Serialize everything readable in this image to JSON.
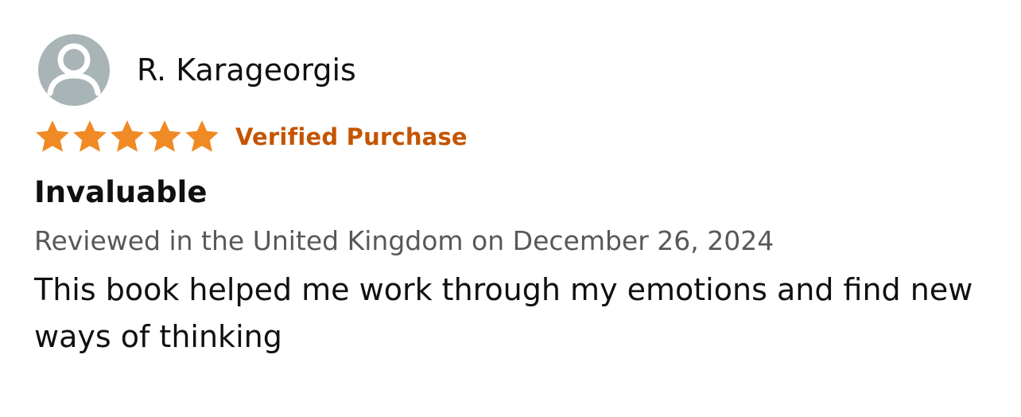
{
  "review": {
    "profile": {
      "name": "R. Karageorgis",
      "avatar_icon": "default-user-avatar-icon"
    },
    "rating": {
      "stars": 5,
      "max_stars": 5,
      "star_icon": "filled-star-icon"
    },
    "badge": "Verified Purchase",
    "title": "Invaluable",
    "meta": "Reviewed in the United Kingdom on December 26, 2024",
    "body": "This book helped me work through my emotions and find new ways of thinking"
  },
  "colors": {
    "star": "#f08a24",
    "verified": "#c45500",
    "avatar_bg": "#a9b4b7",
    "meta_text": "#565959",
    "text": "#0f1111"
  }
}
